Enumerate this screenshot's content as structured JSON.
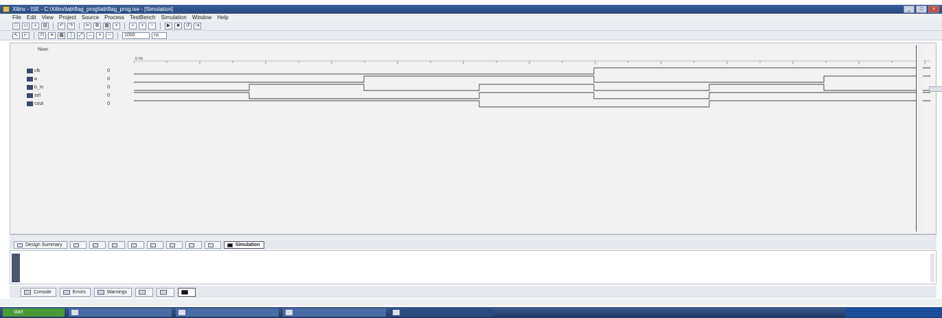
{
  "top_strip": "",
  "window": {
    "title": "Xilinx - ISE - C:\\Xilinx\\lab\\flag_prog\\lab\\flag_prog.ise - [Simulation]",
    "controls": [
      "_",
      "□",
      "×"
    ]
  },
  "menu": [
    "File",
    "Edit",
    "View",
    "Project",
    "Source",
    "Process",
    "TestBench",
    "Simulation",
    "Window",
    "Help"
  ],
  "toolbar1": [
    "new-icon",
    "open-icon",
    "save-icon",
    "print-icon",
    "undo-icon",
    "redo-icon",
    "cut-icon",
    "copy-icon",
    "paste-icon",
    "delete-icon",
    "find-icon",
    "zoom-in-icon",
    "zoom-out-icon",
    "run-icon",
    "stop-icon",
    "restart-icon",
    "step-icon"
  ],
  "toolbar2": [
    "pointer-icon",
    "marker-icon",
    "waveform-icon",
    "bus-icon",
    "grid-icon",
    "cursor-icon",
    "zoom-fit-icon",
    "measure-icon",
    "add-icon",
    "remove-icon"
  ],
  "toolbar2_field": "1000",
  "toolbar2_unit": "ns",
  "wave": {
    "header_line1": "Now:",
    "header_line2": "",
    "right_readout": "",
    "signals": [
      {
        "name": "clk",
        "value": "0"
      },
      {
        "name": "a",
        "value": "0"
      },
      {
        "name": "b_in",
        "value": "0"
      },
      {
        "name": "sel",
        "value": "0"
      },
      {
        "name": "cout",
        "value": "0"
      }
    ],
    "time_labels": [
      "0 ns",
      "",
      "",
      "",
      ""
    ]
  },
  "hscroll_label": "",
  "doc_tabs": [
    {
      "label": "Design Summary",
      "active": false
    },
    {
      "label": "",
      "active": false
    },
    {
      "label": "",
      "active": false
    },
    {
      "label": "",
      "active": false
    },
    {
      "label": "",
      "active": false
    },
    {
      "label": "",
      "active": false
    },
    {
      "label": "",
      "active": false
    },
    {
      "label": "",
      "active": false
    },
    {
      "label": "",
      "active": false
    },
    {
      "label": "Simulation",
      "active": true
    }
  ],
  "console": {
    "lines": [
      "",
      "",
      ""
    ]
  },
  "bottom_tabs": [
    {
      "label": "Console",
      "active": false
    },
    {
      "label": "Errors",
      "active": false
    },
    {
      "label": "Warnings",
      "active": false
    },
    {
      "label": "",
      "active": false
    },
    {
      "label": "",
      "active": false
    },
    {
      "label": "",
      "active": true
    }
  ],
  "status": "",
  "taskbar": {
    "start": "start",
    "tasks": [
      {
        "label": "",
        "active": false
      },
      {
        "label": "",
        "active": false
      },
      {
        "label": "",
        "active": false
      },
      {
        "label": "",
        "active": true
      }
    ],
    "tray": ""
  }
}
